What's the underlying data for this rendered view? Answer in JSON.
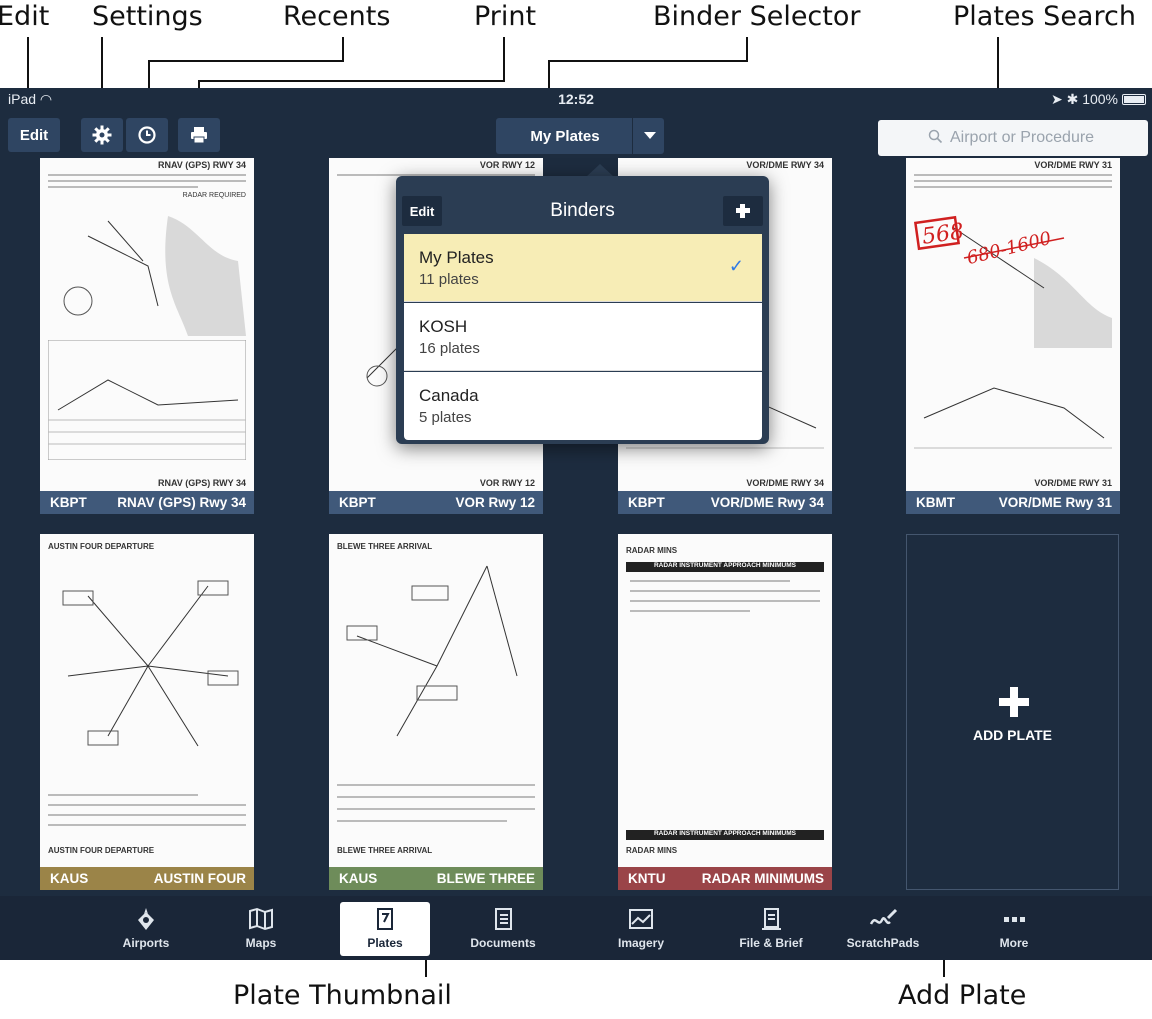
{
  "annotations": {
    "edit": "Edit",
    "settings": "Settings",
    "recents": "Recents",
    "print": "Print",
    "binder_selector": "Binder Selector",
    "plates_search": "Plates Search",
    "plate_thumbnail": "Plate Thumbnail",
    "add_plate": "Add Plate"
  },
  "status_bar": {
    "device": "iPad",
    "time": "12:52",
    "battery": "100%"
  },
  "toolbar": {
    "edit_label": "Edit",
    "binder_label": "My Plates",
    "search_placeholder": "Airport or Procedure"
  },
  "binders_popover": {
    "title": "Binders",
    "edit_label": "Edit",
    "items": [
      {
        "name": "My Plates",
        "count": "11 plates",
        "selected": true
      },
      {
        "name": "KOSH",
        "count": "16 plates",
        "selected": false
      },
      {
        "name": "Canada",
        "count": "5 plates",
        "selected": false
      }
    ]
  },
  "plates": [
    {
      "airport": "KBPT",
      "name": "RNAV (GPS) Rwy 34",
      "color": "#40597a",
      "header": "RNAV (GPS) RWY 34",
      "note": "RADAR REQUIRED"
    },
    {
      "airport": "KBPT",
      "name": "VOR Rwy 12",
      "color": "#40597a",
      "header": "VOR RWY 12"
    },
    {
      "airport": "KBPT",
      "name": "VOR/DME Rwy 34",
      "color": "#40597a",
      "header": "VOR/DME RWY 34"
    },
    {
      "airport": "KBMT",
      "name": "VOR/DME Rwy 31",
      "color": "#40597a",
      "header": "VOR/DME RWY 31",
      "handwriting": [
        "568",
        "680-1600"
      ]
    },
    {
      "airport": "KAUS",
      "name": "AUSTIN FOUR",
      "color": "#9b8448",
      "header": "AUSTIN FOUR DEPARTURE"
    },
    {
      "airport": "KAUS",
      "name": "BLEWE THREE",
      "color": "#6e8c5a",
      "header": "BLEWE THREE ARRIVAL"
    },
    {
      "airport": "KNTU",
      "name": "RADAR MINIMUMS",
      "color": "#9a4448",
      "header": "RADAR MINS",
      "banner": "RADAR INSTRUMENT APPROACH MINIMUMS"
    }
  ],
  "add_plate_label": "ADD PLATE",
  "tabs": [
    {
      "label": "Airports",
      "icon": "airport-icon"
    },
    {
      "label": "Maps",
      "icon": "map-icon"
    },
    {
      "label": "Plates",
      "icon": "plates-icon",
      "active": true
    },
    {
      "label": "Documents",
      "icon": "documents-icon"
    },
    {
      "label": "Imagery",
      "icon": "imagery-icon"
    },
    {
      "label": "File & Brief",
      "icon": "file-brief-icon"
    },
    {
      "label": "ScratchPads",
      "icon": "scratchpad-icon"
    },
    {
      "label": "More",
      "icon": "more-icon"
    }
  ]
}
